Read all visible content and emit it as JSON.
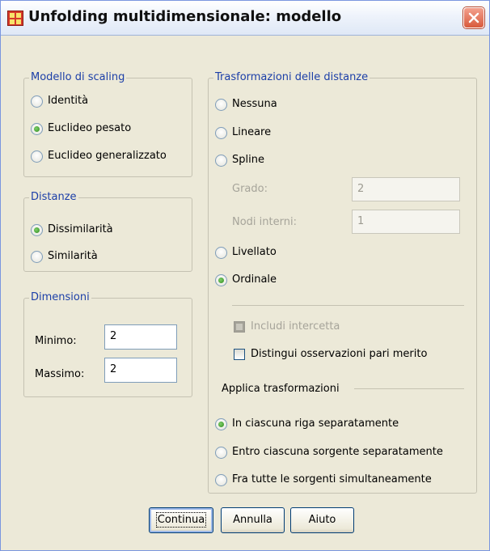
{
  "window": {
    "title": "Unfolding multidimensionale: modello"
  },
  "scaling_model": {
    "label": "Modello di scaling",
    "options": [
      {
        "label": "Identità",
        "selected": false
      },
      {
        "label": "Euclideo pesato",
        "selected": true
      },
      {
        "label": "Euclideo generalizzato",
        "selected": false
      }
    ]
  },
  "distances": {
    "label": "Distanze",
    "options": [
      {
        "label": "Dissimilarità",
        "selected": true
      },
      {
        "label": "Similarità",
        "selected": false
      }
    ]
  },
  "dimensions": {
    "label": "Dimensioni",
    "min_label": "Minimo:",
    "min_value": "2",
    "max_label": "Massimo:",
    "max_value": "2"
  },
  "transformations": {
    "label": "Trasformazioni delle distanze",
    "options": [
      {
        "label": "Nessuna",
        "selected": false
      },
      {
        "label": "Lineare",
        "selected": false
      },
      {
        "label": "Spline",
        "selected": false
      },
      {
        "label": "Livellato",
        "selected": false
      },
      {
        "label": "Ordinale",
        "selected": true
      }
    ],
    "degree_label": "Grado:",
    "degree_value": "2",
    "knots_label": "Nodi interni:",
    "knots_value": "1",
    "include_intercept": "Includi intercetta",
    "untie_tied": "Distingui osservazioni pari merito",
    "apply_label": "Applica trasformazioni",
    "apply_options": [
      {
        "label": "In ciascuna riga separatamente",
        "selected": true
      },
      {
        "label": "Entro ciascuna sorgente separatamente",
        "selected": false
      },
      {
        "label": "Fra tutte le sorgenti simultaneamente",
        "selected": false
      }
    ]
  },
  "buttons": {
    "continue": "Continua",
    "cancel": "Annulla",
    "help": "Aiuto"
  }
}
